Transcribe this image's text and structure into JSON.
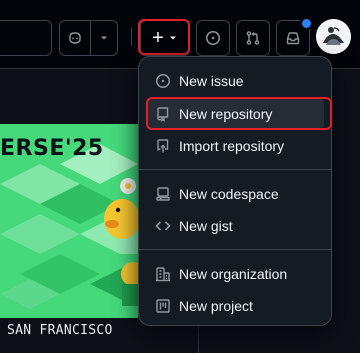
{
  "header": {
    "create_button": "+",
    "notification_unread": true
  },
  "banner": {
    "title": "ERSE'25",
    "location": "SAN FRANCISCO"
  },
  "create_menu": {
    "items": [
      {
        "label": "New issue",
        "icon": "issue-opened-icon"
      },
      {
        "label": "New repository",
        "icon": "repo-icon"
      },
      {
        "label": "Import repository",
        "icon": "repo-push-icon"
      },
      {
        "label": "New codespace",
        "icon": "codespaces-icon"
      },
      {
        "label": "New gist",
        "icon": "code-icon"
      },
      {
        "label": "New organization",
        "icon": "organization-icon"
      },
      {
        "label": "New project",
        "icon": "project-icon"
      }
    ],
    "selected": "New repository"
  },
  "colors": {
    "highlight": "#e5202a",
    "menu_bg": "#151b23",
    "header_bg": "#010409",
    "banner_green": "#3ad06e",
    "notification_dot": "#2f81f7"
  }
}
